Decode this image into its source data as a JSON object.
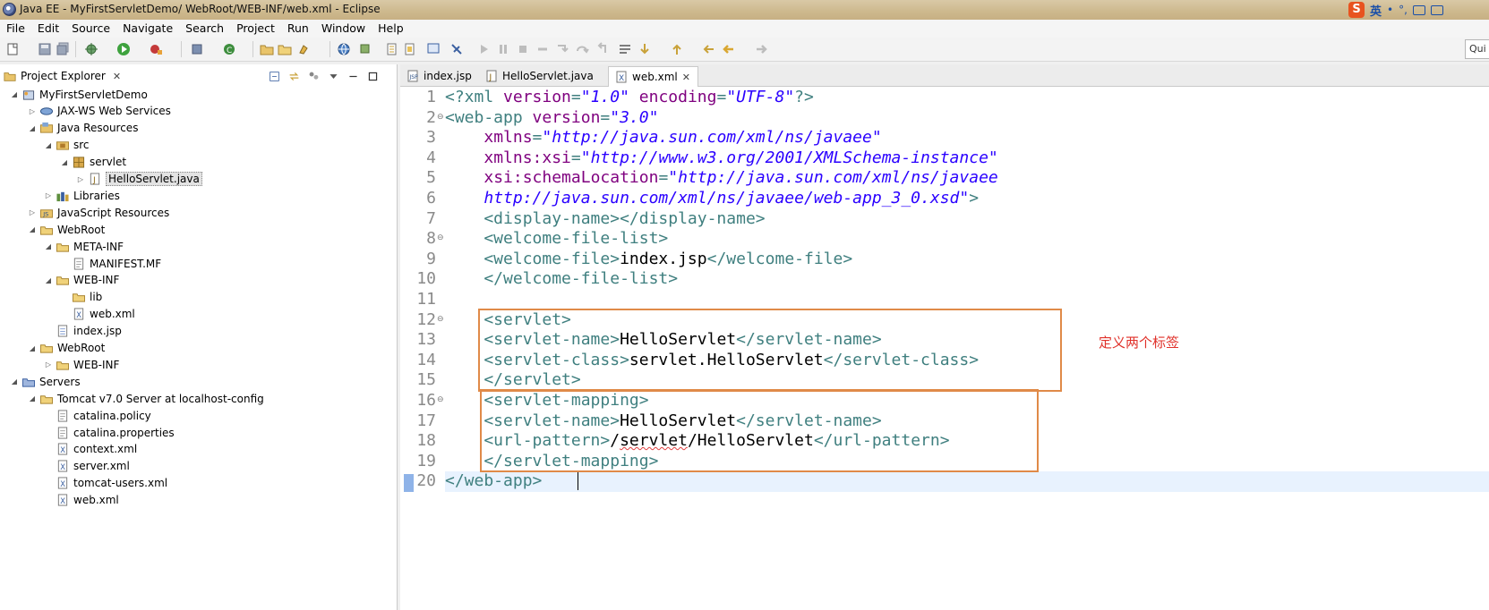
{
  "window": {
    "title": "Java EE - MyFirstServletDemo/ WebRoot/WEB-INF/web.xml - Eclipse",
    "ime": {
      "logo": "S",
      "lang": "英",
      "dot": "•",
      "symbol": "°,"
    }
  },
  "menu": [
    "File",
    "Edit",
    "Source",
    "Navigate",
    "Search",
    "Project",
    "Run",
    "Window",
    "Help"
  ],
  "toolbar": {
    "quick_access": "Qui"
  },
  "explorer": {
    "tab_label": "Project Explorer",
    "tab_close": "✕",
    "tree": [
      {
        "label": "MyFirstServletDemo",
        "icon": "project-icon",
        "twisty": "◢"
      },
      {
        "label": "JAX-WS Web Services",
        "icon": "webservices-icon",
        "twisty": "▷"
      },
      {
        "label": "Java Resources",
        "icon": "java-resources-icon",
        "twisty": "◢"
      },
      {
        "label": "src",
        "icon": "source-folder-icon",
        "twisty": "◢"
      },
      {
        "label": "servlet",
        "icon": "package-icon",
        "twisty": "◢"
      },
      {
        "label": "HelloServlet.java",
        "icon": "java-file-icon",
        "twisty": "▷",
        "selected": true
      },
      {
        "label": "Libraries",
        "icon": "libraries-icon",
        "twisty": "▷"
      },
      {
        "label": "JavaScript Resources",
        "icon": "javascript-icon",
        "twisty": "▷"
      },
      {
        "label": "WebRoot",
        "icon": "folder-icon",
        "twisty": "◢"
      },
      {
        "label": "META-INF",
        "icon": "folder-icon",
        "twisty": "◢"
      },
      {
        "label": "MANIFEST.MF",
        "icon": "text-file-icon",
        "twisty": ""
      },
      {
        "label": "WEB-INF",
        "icon": "folder-icon",
        "twisty": "◢"
      },
      {
        "label": "lib",
        "icon": "folder-icon",
        "twisty": ""
      },
      {
        "label": "web.xml",
        "icon": "xml-file-icon",
        "twisty": ""
      },
      {
        "label": "index.jsp",
        "icon": "jsp-file-icon",
        "twisty": ""
      },
      {
        "label": "WebRoot",
        "icon": "folder-icon",
        "twisty": "◢"
      },
      {
        "label": "WEB-INF",
        "icon": "folder-icon",
        "twisty": "▷"
      },
      {
        "label": "Servers",
        "icon": "servers-folder-icon",
        "twisty": "◢"
      },
      {
        "label": "Tomcat v7.0 Server at localhost-config",
        "icon": "folder-icon",
        "twisty": "◢"
      },
      {
        "label": "catalina.policy",
        "icon": "text-file-icon",
        "twisty": ""
      },
      {
        "label": "catalina.properties",
        "icon": "text-file-icon",
        "twisty": ""
      },
      {
        "label": "context.xml",
        "icon": "xml-file-icon",
        "twisty": ""
      },
      {
        "label": "server.xml",
        "icon": "xml-file-icon",
        "twisty": ""
      },
      {
        "label": "tomcat-users.xml",
        "icon": "xml-file-icon",
        "twisty": ""
      },
      {
        "label": "web.xml",
        "icon": "xml-file-icon",
        "twisty": ""
      }
    ]
  },
  "editor": {
    "tabs": [
      {
        "label": "index.jsp",
        "icon": "jsp-file-icon",
        "active": false
      },
      {
        "label": "HelloServlet.java",
        "icon": "java-file-icon",
        "active": false
      },
      {
        "label": "web.xml",
        "icon": "xml-file-icon",
        "active": true,
        "close": "✕"
      }
    ],
    "fold_marker": "⊖",
    "lines": [
      {
        "num": "1",
        "tokens": [
          [
            "tag",
            "<?xml "
          ],
          [
            "attr",
            "version"
          ],
          [
            "tag",
            "="
          ],
          [
            "val",
            "\"1.0\""
          ],
          [
            "tag",
            " "
          ],
          [
            "attr",
            "encoding"
          ],
          [
            "tag",
            "="
          ],
          [
            "val",
            "\"UTF-8\""
          ],
          [
            "tag",
            "?>"
          ]
        ]
      },
      {
        "num": "2",
        "fold": true,
        "tokens": [
          [
            "tag",
            "<web-app "
          ],
          [
            "attr",
            "version"
          ],
          [
            "tag",
            "="
          ],
          [
            "val",
            "\"3.0\""
          ]
        ]
      },
      {
        "num": "3",
        "tokens": [
          [
            "tag",
            "    "
          ],
          [
            "attr",
            "xmlns"
          ],
          [
            "tag",
            "="
          ],
          [
            "val",
            "\"http://java.sun.com/xml/ns/javaee\""
          ]
        ]
      },
      {
        "num": "4",
        "tokens": [
          [
            "tag",
            "    "
          ],
          [
            "attr",
            "xmlns:xsi"
          ],
          [
            "tag",
            "="
          ],
          [
            "val",
            "\"http://www.w3.org/2001/XMLSchema-instance\""
          ]
        ]
      },
      {
        "num": "5",
        "tokens": [
          [
            "tag",
            "    "
          ],
          [
            "attr",
            "xsi:schemaLocation"
          ],
          [
            "tag",
            "="
          ],
          [
            "val",
            "\"http://java.sun.com/xml/ns/javaee"
          ]
        ]
      },
      {
        "num": "6",
        "tokens": [
          [
            "tag",
            "    "
          ],
          [
            "val",
            "http://java.sun.com/xml/ns/javaee/web-app_3_0.xsd\""
          ],
          [
            "tag",
            ">"
          ]
        ]
      },
      {
        "num": "7",
        "tokens": [
          [
            "tag",
            "    <display-name></display-name>"
          ]
        ]
      },
      {
        "num": "8",
        "fold": true,
        "tokens": [
          [
            "tag",
            "    <welcome-file-list>"
          ]
        ]
      },
      {
        "num": "9",
        "tokens": [
          [
            "tag",
            "    <welcome-file>"
          ],
          [
            "txt",
            "index.jsp"
          ],
          [
            "tag",
            "</welcome-file>"
          ]
        ]
      },
      {
        "num": "10",
        "tokens": [
          [
            "tag",
            "    </welcome-file-list>"
          ]
        ]
      },
      {
        "num": "11",
        "tokens": []
      },
      {
        "num": "12",
        "fold": true,
        "tokens": [
          [
            "tag",
            "    <servlet>"
          ]
        ]
      },
      {
        "num": "13",
        "tokens": [
          [
            "tag",
            "    <servlet-name>"
          ],
          [
            "txt",
            "HelloServlet"
          ],
          [
            "tag",
            "</servlet-name>"
          ]
        ]
      },
      {
        "num": "14",
        "tokens": [
          [
            "tag",
            "    <servlet-class>"
          ],
          [
            "txt",
            "servlet.HelloServlet"
          ],
          [
            "tag",
            "</servlet-class>"
          ]
        ]
      },
      {
        "num": "15",
        "tokens": [
          [
            "tag",
            "    </servlet>"
          ]
        ]
      },
      {
        "num": "16",
        "fold": true,
        "tokens": [
          [
            "tag",
            "    <servlet-mapping>"
          ]
        ]
      },
      {
        "num": "17",
        "tokens": [
          [
            "tag",
            "    <servlet-name>"
          ],
          [
            "txt",
            "HelloServlet"
          ],
          [
            "tag",
            "</servlet-name>"
          ]
        ]
      },
      {
        "num": "18",
        "tokens": [
          [
            "tag",
            "    <url-pattern>"
          ],
          [
            "txt",
            "/"
          ],
          [
            "sq",
            "servlet"
          ],
          [
            "txt",
            "/HelloServlet"
          ],
          [
            "tag",
            "</url-pattern>"
          ]
        ]
      },
      {
        "num": "19",
        "tokens": [
          [
            "tag",
            "    </servlet-mapping>"
          ]
        ]
      },
      {
        "num": "20",
        "tokens": [
          [
            "tag",
            "</web-app>"
          ]
        ]
      }
    ],
    "annotation": "定义两个标签"
  },
  "colors": {
    "tag": "#3f7f7f",
    "attr": "#7f007f",
    "value": "#2a00ff",
    "annotation_box": "#e08a48",
    "annotation_text": "#e0312a",
    "current_line": "#e8f2fe"
  }
}
